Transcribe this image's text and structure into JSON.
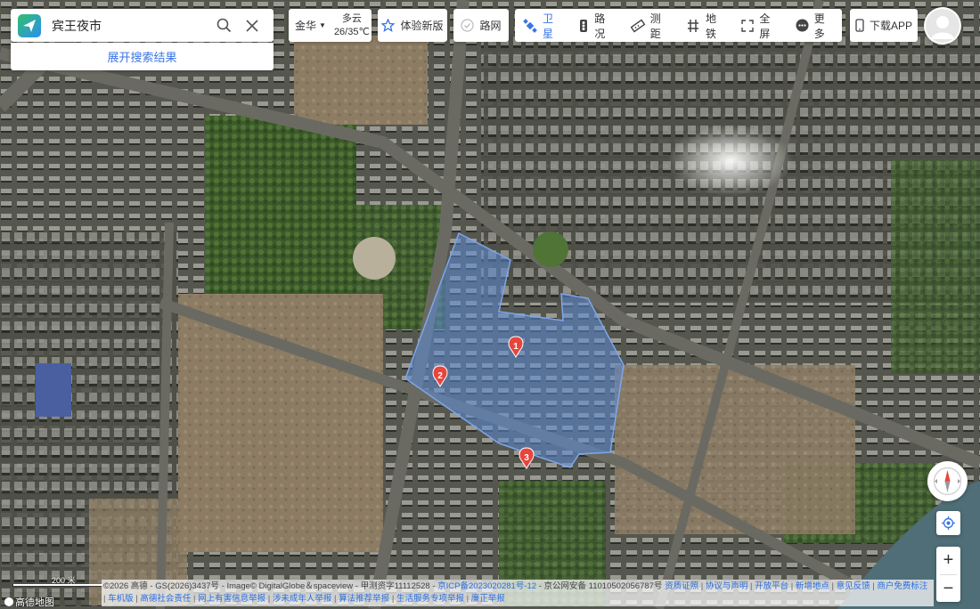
{
  "search": {
    "query": "宾王夜市",
    "expand_label": "展开搜索结果"
  },
  "weather": {
    "city": "金华",
    "condition": "多云",
    "temperature": "26/35℃"
  },
  "toolbar": {
    "new_version": "体验新版",
    "road_network": "路网",
    "group": [
      {
        "label": "卫星",
        "icon": "satellite-icon",
        "active": true
      },
      {
        "label": "路况",
        "icon": "traffic-icon",
        "active": false
      },
      {
        "label": "测距",
        "icon": "ruler-icon",
        "active": false
      },
      {
        "label": "地铁",
        "icon": "subway-icon",
        "active": false
      },
      {
        "label": "全屏",
        "icon": "fullscreen-icon",
        "active": false
      },
      {
        "label": "更多",
        "icon": "more-icon",
        "active": false
      }
    ],
    "download_app": "下载APP"
  },
  "markers": [
    "1",
    "2",
    "3"
  ],
  "scale": {
    "label": "200 米"
  },
  "logo": {
    "text": "高德地图"
  },
  "accent_color": "#3a75e6",
  "highlight_color": "#5c8bd6",
  "marker_color": "#e8453c",
  "copyright": {
    "line1_text": "©2026 高德 - GS(2026)3437号 - Image© DigitalGlobe＆spaceview - 甲测资字11112528 - ",
    "icp": "京ICP备2023020281号-12",
    "police": " - 京公网安备 11010502056787号 ",
    "links": [
      "资质证照",
      "协议与声明",
      "开放平台",
      "新增地点",
      "意见反馈",
      "商户免费标注",
      "车机版",
      "高德社会责任",
      "网上有害信息举报",
      "涉未成年人举报",
      "算法推荐举报",
      "生活服务专项举报",
      "廉正举报"
    ]
  }
}
